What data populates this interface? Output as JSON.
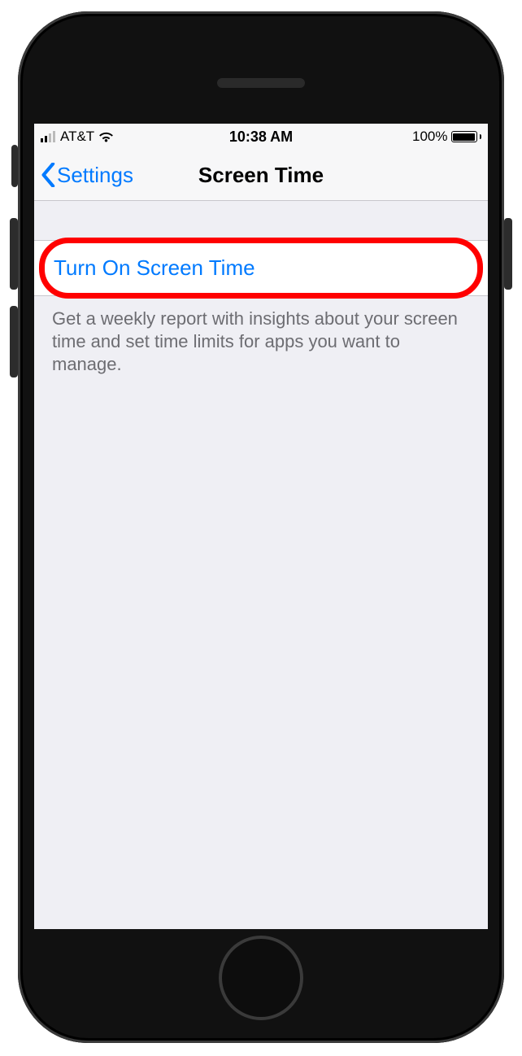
{
  "status_bar": {
    "carrier": "AT&T",
    "time": "10:38 AM",
    "battery_percent": "100%",
    "signal_active_bars": 2
  },
  "nav": {
    "back_label": "Settings",
    "title": "Screen Time"
  },
  "main": {
    "turn_on_label": "Turn On Screen Time",
    "footer_text": "Get a weekly report with insights about your screen time and set time limits for apps you want to manage."
  },
  "annotation": {
    "highlight_color": "#ff0000"
  }
}
